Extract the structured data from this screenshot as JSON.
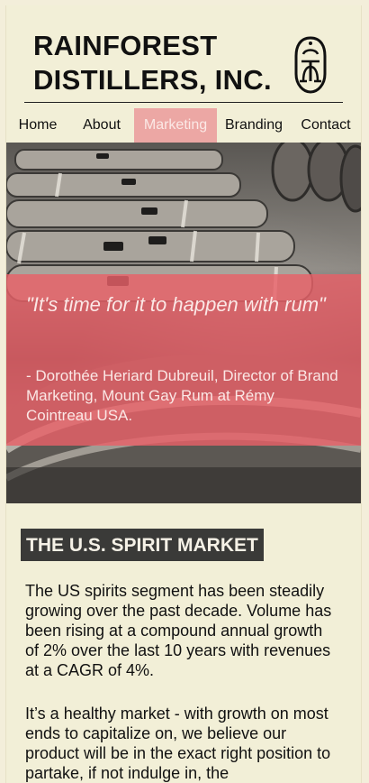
{
  "header": {
    "brand": "RAINFOREST\nDISTILLERS, INC.",
    "logo_icon": "ornamental-monogram-icon"
  },
  "nav": {
    "items": [
      {
        "label": "Home",
        "active": false
      },
      {
        "label": "About",
        "active": false
      },
      {
        "label": "Marketing",
        "active": true
      },
      {
        "label": "Branding",
        "active": false
      },
      {
        "label": "Contact",
        "active": false
      }
    ]
  },
  "hero": {
    "image": "rum-barrels-photo",
    "quote": "\"It's time for it to happen with rum\"",
    "attribution": "- Dorothée Heriard Dubreuil, Director of Brand Marketing, Mount Gay Rum at Rémy Cointreau USA."
  },
  "section": {
    "title": "THE U.S. SPIRIT MARKET",
    "paragraph_1": "The US spirits segment has been steadily growing over the past decade. Volume has been rising at a compound annual growth of 2% over the last 10 years with revenues at a CAGR of 4%.",
    "paragraph_2": "It’s a healthy market - with growth on most ends to capitalize on, we believe our product will be in the exact right position to partake, if not indulge in, the"
  },
  "colors": {
    "background": "#f2efd7",
    "accent": "#e8606a",
    "nav_active": "#eca7a4",
    "title_bg": "#3a3a38"
  }
}
